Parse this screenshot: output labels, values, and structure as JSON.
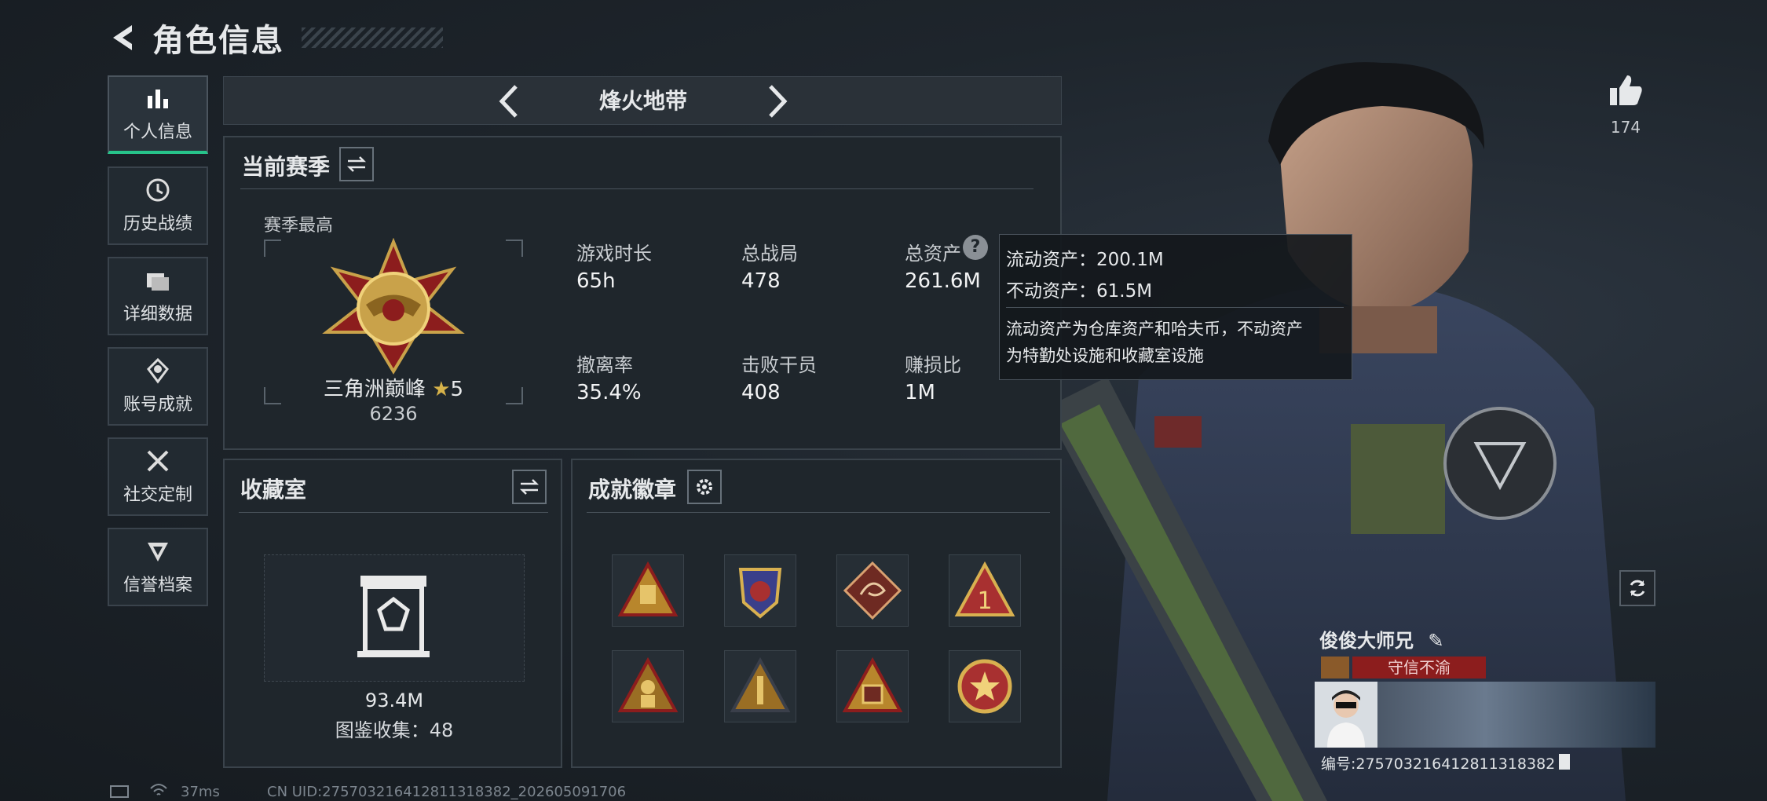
{
  "header": {
    "title": "角色信息"
  },
  "sidebar": {
    "items": [
      {
        "label": "个人信息",
        "icon": "bar-chart-icon",
        "active": true
      },
      {
        "label": "历史战绩",
        "icon": "history-icon"
      },
      {
        "label": "详细数据",
        "icon": "folder-icon"
      },
      {
        "label": "账号成就",
        "icon": "achievement-icon"
      },
      {
        "label": "社交定制",
        "icon": "tools-icon"
      },
      {
        "label": "信誉档案",
        "icon": "reputation-icon"
      }
    ]
  },
  "mode": {
    "title": "烽火地带"
  },
  "season": {
    "title": "当前赛季",
    "best_label": "赛季最高",
    "rank_name": "三角洲巅峰",
    "rank_stars": "5",
    "rank_score": "6236",
    "stats": [
      {
        "label": "游戏时长",
        "value": "65h"
      },
      {
        "label": "总战局",
        "value": "478"
      },
      {
        "label": "总资产",
        "value": "261.6M"
      },
      {
        "label": "撤离率",
        "value": "35.4%"
      },
      {
        "label": "击败干员",
        "value": "408"
      },
      {
        "label": "赚损比",
        "value": "1M"
      }
    ]
  },
  "tooltip": {
    "line1": "流动资产：200.1M",
    "line2": "不动资产：61.5M",
    "desc1": "流动资产为仓库资产和哈夫币，不动资产",
    "desc2": "为特勤处设施和收藏室设施"
  },
  "collection": {
    "title": "收藏室",
    "value": "93.4M",
    "count_text": "图鉴收集：48"
  },
  "badges": {
    "title": "成就徽章"
  },
  "player": {
    "likes": "174",
    "name": "俊俊大师兄",
    "title_badge": "守信不渝",
    "uid_text": "编号:275703216412811318382"
  },
  "status": {
    "ping": "37ms",
    "cn_uid": "CN UID:275703216412811318382_202605091706"
  },
  "colors": {
    "accent_green": "#27c38a",
    "title_red": "#8c1d1d",
    "gold": "#c9a24a"
  }
}
